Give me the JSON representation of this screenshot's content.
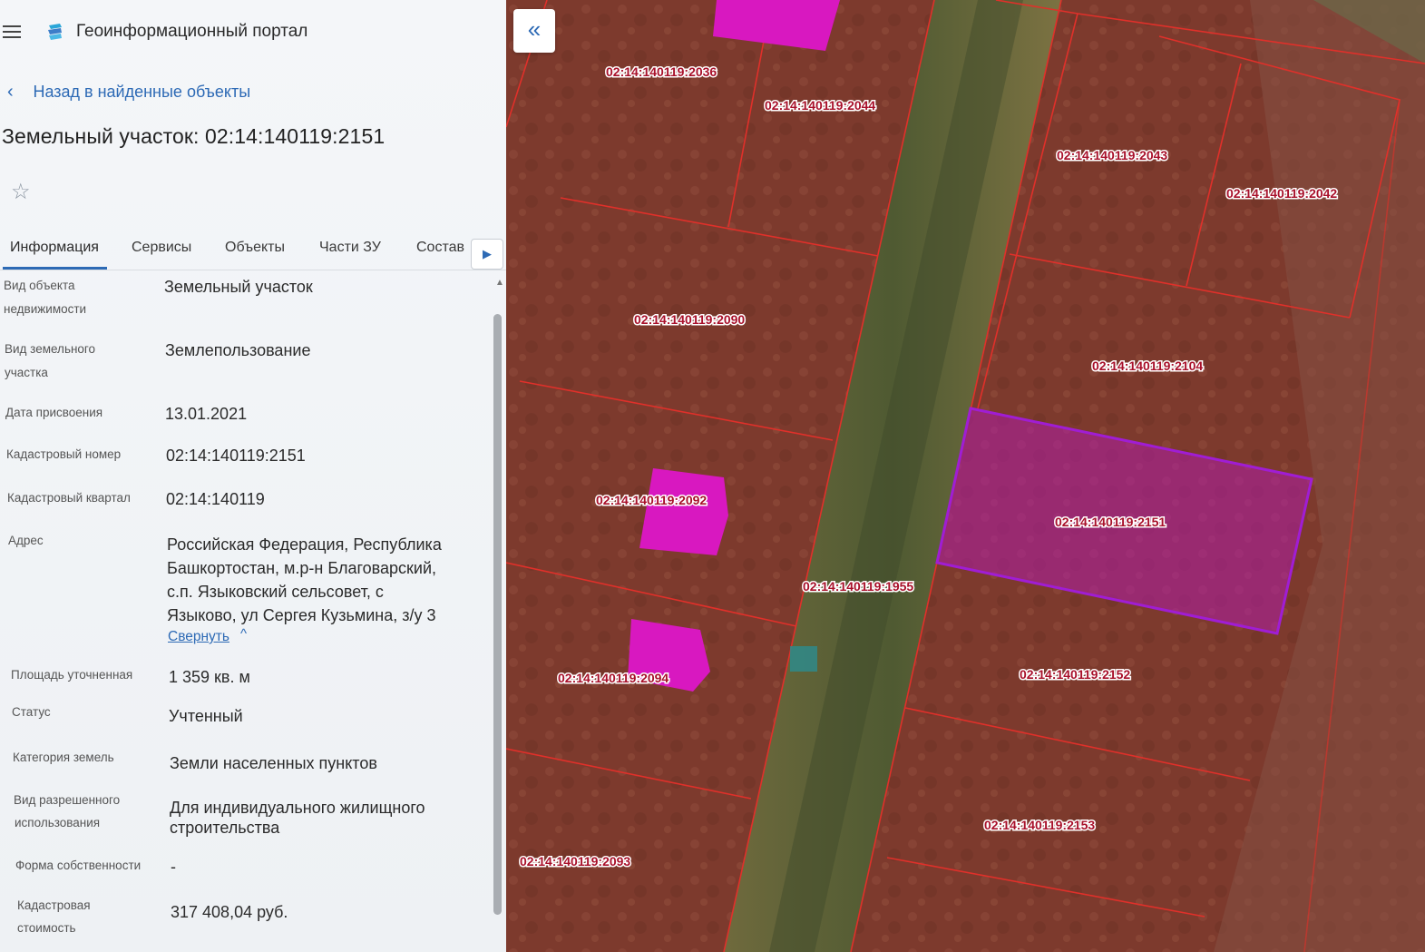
{
  "header": {
    "app_title": "Геоинформационный портал"
  },
  "back_link": {
    "label": "Назад в найденные объекты"
  },
  "object": {
    "title": "Земельный участок: 02:14:140119:2151"
  },
  "tabs": [
    {
      "label": "Информация",
      "active": true
    },
    {
      "label": "Сервисы",
      "active": false
    },
    {
      "label": "Объекты",
      "active": false
    },
    {
      "label": "Части ЗУ",
      "active": false
    },
    {
      "label": "Состав",
      "active": false
    }
  ],
  "info": {
    "object_type": {
      "label_line1": "Вид объекта",
      "label_line2": "недвижимости",
      "value": "Земельный участок"
    },
    "land_type": {
      "label_line1": "Вид земельного",
      "label_line2": "участка",
      "value": "Землепользование"
    },
    "assign_date": {
      "label": "Дата присвоения",
      "value": "13.01.2021"
    },
    "cadastral_number": {
      "label": "Кадастровый номер",
      "value": "02:14:140119:2151"
    },
    "cadastral_quarter": {
      "label": "Кадастровый квартал",
      "value": "02:14:140119"
    },
    "address": {
      "label": "Адрес",
      "line1": "Российская Федерация, Республика",
      "line2": "Башкортостан, м.р-н Благоварский,",
      "line3": "с.п. Языковский сельсовет, с",
      "line4": "Языково, ул Сергея Кузьмина, з/у 3",
      "collapse_label": "Свернуть"
    },
    "area": {
      "label": "Площадь уточненная",
      "value": "1 359 кв. м"
    },
    "status": {
      "label": "Статус",
      "value": "Учтенный"
    },
    "category": {
      "label": "Категория земель",
      "value": "Земли населенных пунктов"
    },
    "permitted_use": {
      "label_line1": "Вид разрешенного",
      "label_line2": "использования",
      "value_line1": "Для индивидуального жилищного",
      "value_line2": "строительства"
    },
    "ownership": {
      "label": "Форма собственности",
      "value": "-"
    },
    "cadastral_value": {
      "label_line1": "Кадастровая",
      "label_line2": "стоимость",
      "value": "317 408,04 руб."
    }
  },
  "map": {
    "parcel_labels": [
      "02:14:140119:2036",
      "02:14:140119:2044",
      "02:14:140119:2043",
      "02:14:140119:2042",
      "02:14:140119:2090",
      "02:14:140119:2104",
      "02:14:140119:2092",
      "02:14:140119:2151",
      "02:14:140119:1955",
      "02:14:140119:2094",
      "02:14:140119:2152",
      "02:14:140119:2153",
      "02:14:140119:2093"
    ]
  },
  "icons": {
    "menu": "hamburger-icon",
    "logo": "portal-logo-icon",
    "back": "chevron-left-icon",
    "favorite": "star-icon",
    "tabs_next": "chevron-right-icon",
    "collapse_panel": "double-chevron-left-icon"
  },
  "colors": {
    "accent": "#2d6ab5",
    "parcel_border": "#e0302a",
    "selected_parcel": "#b01ea8",
    "building": "#d818c0"
  }
}
